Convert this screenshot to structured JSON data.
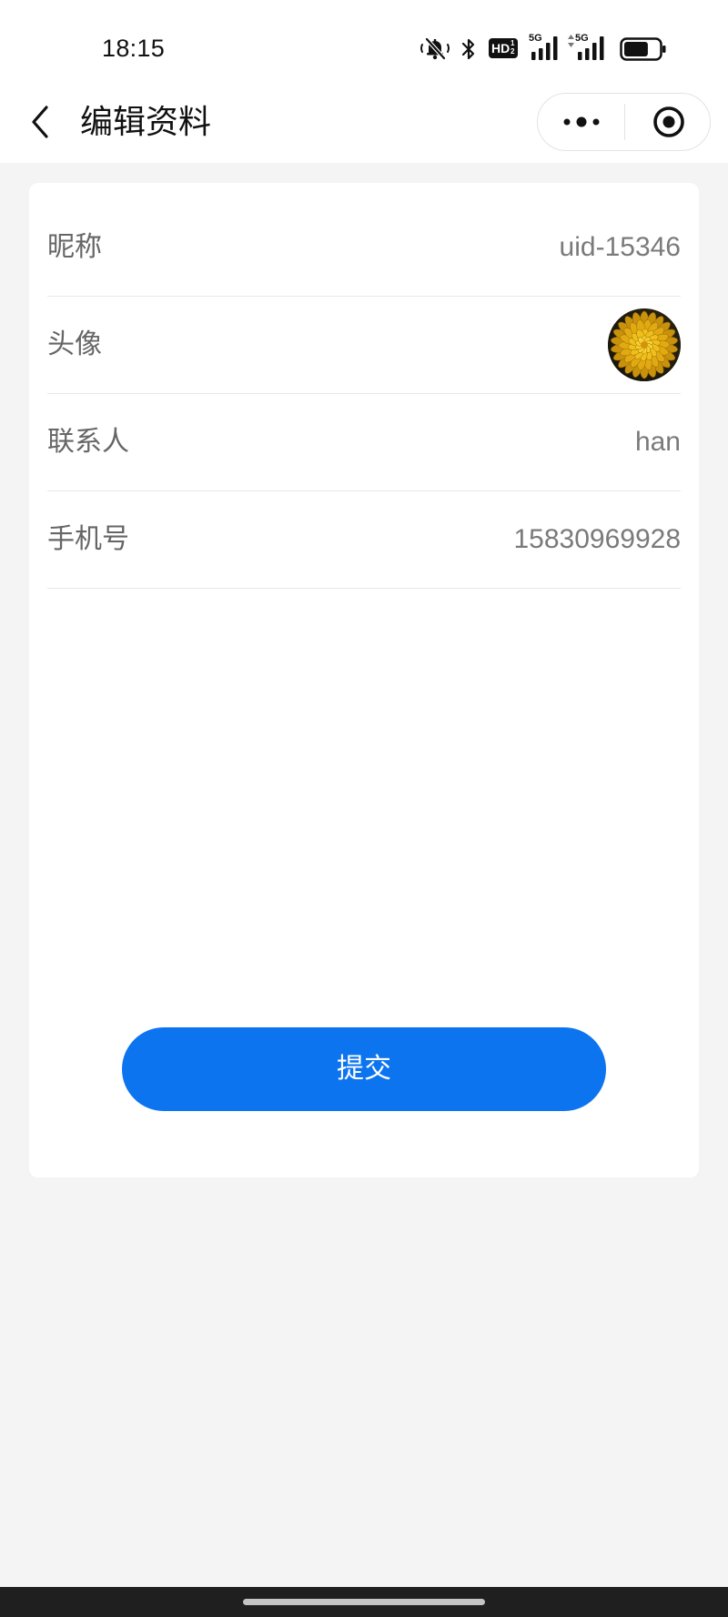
{
  "status_bar": {
    "time": "18:15",
    "icons": [
      "bell-off-vibrate-icon",
      "bluetooth-icon",
      "hd-voice-icon",
      "signal-5g-icon",
      "signal-5g-data-icon",
      "battery-icon"
    ],
    "hd_label": "HD",
    "hd_sup": "1",
    "hd_sub": "2",
    "signal_labels": [
      "5G",
      "5G"
    ],
    "battery_level": 0.7
  },
  "nav": {
    "back_icon": "chevron-left-icon",
    "title": "编辑资料",
    "more_icon": "more-dots-icon",
    "close_icon": "target-circle-icon"
  },
  "profile_form": {
    "rows": [
      {
        "label": "昵称",
        "value": "uid-15346"
      },
      {
        "label": "头像",
        "avatar": "flower-avatar"
      },
      {
        "label": "联系人",
        "value": "han"
      },
      {
        "label": "手机号",
        "value": "15830969928"
      }
    ]
  },
  "submit": {
    "label": "提交"
  },
  "colors": {
    "primary": "#0D74F0",
    "background": "#F4F4F4",
    "card": "#FFFFFF",
    "label": "#666666",
    "value": "#7A7A7A",
    "divider": "#E8E8E8",
    "system_bar": "#1F1F1F"
  }
}
